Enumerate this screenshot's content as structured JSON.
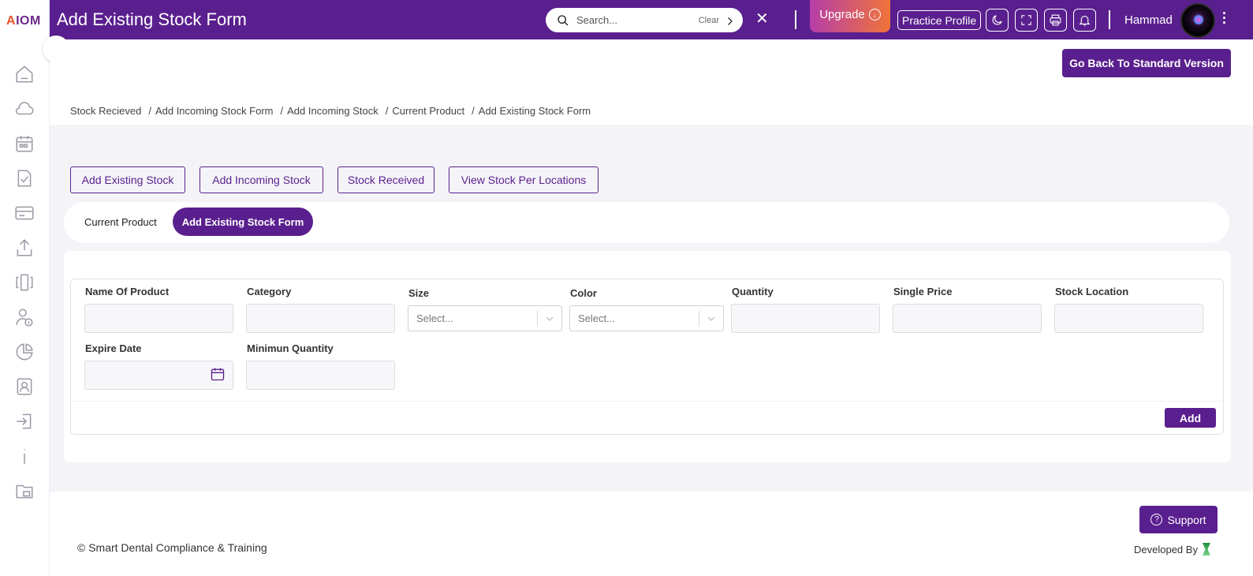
{
  "app": {
    "logo": "AIOM",
    "title": "Add Existing Stock Form"
  },
  "header": {
    "search_placeholder": "Search...",
    "clear_label": "Clear",
    "close_symbol": "✕",
    "upgrade_label": "Upgrade",
    "practice_profile_label": "Practice Profile",
    "username": "Hammad"
  },
  "go_back_label": "Go Back To Standard Version",
  "breadcrumb": [
    "Stock Recieved",
    "Add Incoming Stock Form",
    "Add Incoming Stock",
    "Current Product",
    "Add Existing Stock Form"
  ],
  "tabs": [
    "Add Existing Stock",
    "Add Incoming Stock",
    "Stock Received",
    "View Stock Per Locations"
  ],
  "subtabs": {
    "inactive": "Current Product",
    "active": "Add Existing Stock Form"
  },
  "form": {
    "labels": {
      "name": "Name Of Product",
      "category": "Category",
      "size": "Size",
      "color": "Color",
      "quantity": "Quantity",
      "single_price": "Single Price",
      "stock_location": "Stock Location",
      "expire_date": "Expire Date",
      "min_quantity": "Minimun Quantity"
    },
    "size_value": "Select...",
    "color_value": "Select...",
    "add_label": "Add"
  },
  "footer": {
    "support_label": "Support",
    "copyright": "© Smart Dental Compliance & Training",
    "developed_by": "Developed By"
  },
  "colors": {
    "primary": "#5a1f8e",
    "upgrade_start": "#b53ea8",
    "upgrade_end": "#f0743a"
  },
  "icons": [
    "home-icon",
    "cloud-icon",
    "calendar-icon",
    "checklist-icon",
    "card-icon",
    "upload-icon",
    "columns-icon",
    "user-info-icon",
    "pie-chart-icon",
    "contacts-icon",
    "login-icon",
    "info-icon",
    "archive-icon",
    "search-icon",
    "moon-icon",
    "fullscreen-icon",
    "print-icon",
    "bell-icon"
  ]
}
